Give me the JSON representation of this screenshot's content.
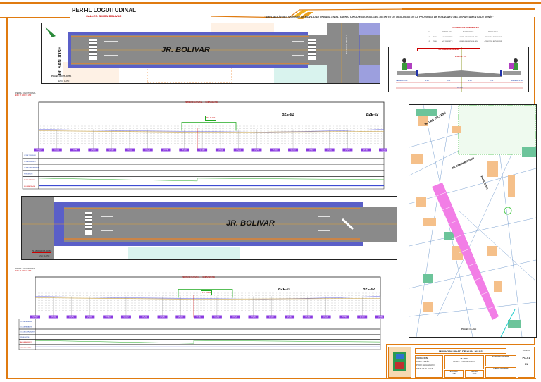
{
  "header": {
    "title": "PERFIL LOGUITUDINAL",
    "subtitle": "CALLES: SIMON BOLIVAR",
    "project": "\"AMPLIACIÓN DEL SERVICIO DE MOVILIDAD URBANA EN EL BARRIO CINCO ESQUINAS, DEL DISTRITO DE HUALHUAS DE LA PROVINCIA DE HUANCAYO DEL DEPARTAMENTO DE JUNÍN\""
  },
  "plan1": {
    "street_main": "JR. BOLIVAR",
    "street_cross": "JR. SAN JOSE",
    "street_cross2": "JR. TUPAC AMARU",
    "label": "PLANO EN PLANTA",
    "scale": "ESC: 1/250"
  },
  "plan2": {
    "street_main": "JR. BOLIVAR",
    "label": "PLANO EN PLANTA",
    "scale": "ESC: 1/250"
  },
  "tangent_table": {
    "title": "CUADRO DE TANGENTES",
    "headers": [
      "N°",
      "L",
      "RUMBO DEL",
      "PUNTO INICIAL",
      "PUNTO FINAL"
    ],
    "rows": [
      [
        "T-1",
        "83.60",
        "S41°18'41.87\"E",
        "473581.69E 8676079.47N",
        "473636.85E 8676016.66N"
      ],
      [
        "T-2",
        "76.40",
        "S41°18'41.87\"E",
        "473636.85E 8676016.66N",
        "473687.29E 8675959.28N"
      ]
    ]
  },
  "section": {
    "title": "JR. SIMON BOLIVAR",
    "axis": "EJE DE VIA",
    "dims": [
      "VEREDA 1.80",
      "0.40",
      "3.00",
      "3.00",
      "0.40",
      "VEREDA 1.80"
    ],
    "total": "10.40"
  },
  "profile1": {
    "title": "PERFIL LONGITUDINAL",
    "scale": "ESC: H 1/500 V 1/50",
    "legend": [
      "TERRENO NATURAL",
      "SUBRASANTE"
    ],
    "bm1": "BZE-01",
    "bm2": "BZE-02",
    "curve": "PVI 0+160",
    "bands": [
      "COTA TERRENO",
      "COTA RASANTE",
      "COTA SUBRASANTE",
      "PENDIENTE",
      "ALINEAMIENTO",
      "KILOMETRAJE"
    ]
  },
  "profile2": {
    "title": "PERFIL LONGITUDINAL",
    "scale": "ESC: H 1/500 V 1/50",
    "legend": [
      "TERRENO NATURAL",
      "SUBRASANTE"
    ],
    "bm1": "BZE-01",
    "bm2": "BZE-02",
    "curve": "PVI 0+160",
    "bands": [
      "COTA TERRENO",
      "COTA RASANTE",
      "COTA SUBRASANTE",
      "PENDIENTE",
      "ALINEAMIENTO",
      "KILOMETRAJE"
    ]
  },
  "stations": [
    "0+000",
    "0+020",
    "0+040",
    "0+060",
    "0+080",
    "0+100",
    "0+120",
    "0+140",
    "0+160",
    "0+180",
    "0+200",
    "0+220",
    "0+240",
    "0+260",
    "0+280",
    "0+300",
    "0+320",
    "0+340",
    "0+360",
    "0+380"
  ],
  "location_map": {
    "street1": "JR. LOS TELARES",
    "street2": "JR. SIMON BOLIVAR",
    "street3": "PASAJE S/N",
    "label": "PLANO CLAVE"
  },
  "title_block": {
    "entity": "MUNICIPALIDAD DE HUALHUAS",
    "fields": [
      "UBICACIÓN",
      "DPTO.: JUNÍN",
      "PROV.: HUANCAYO",
      "DIST.: HUALHUAS"
    ],
    "plan_label": "PLANO:",
    "plan_value": "PERFIL LONGITUDINAL",
    "scale_label": "ESCALA:",
    "scale_value": "1/250",
    "date_label": "FECHA:",
    "date_value": "2023",
    "designer_label": "ELABORADO POR:",
    "reviewer_label": "APROBADO POR:",
    "sheet_label": "LAMINA",
    "sheet_value": "PL-01",
    "sheet_code": "01"
  }
}
